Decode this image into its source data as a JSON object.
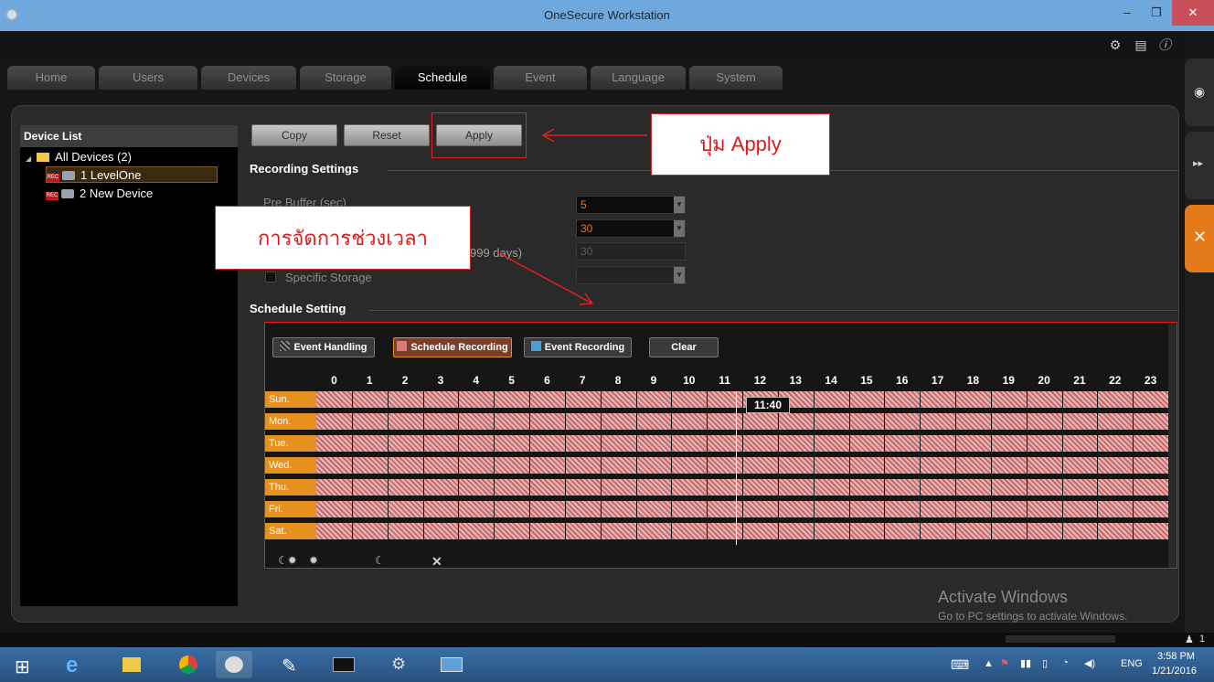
{
  "window": {
    "title": "OneSecure Workstation",
    "minimize": "–",
    "maximize": "❐",
    "close": "✕"
  },
  "tool_icons": [
    "gear-icon",
    "document-icon",
    "info-icon"
  ],
  "tabs": [
    {
      "label": "Home"
    },
    {
      "label": "Users"
    },
    {
      "label": "Devices"
    },
    {
      "label": "Storage"
    },
    {
      "label": "Schedule",
      "active": true
    },
    {
      "label": "Event"
    },
    {
      "label": "Language"
    },
    {
      "label": "System"
    }
  ],
  "device_list": {
    "header": "Device List",
    "root": "All Devices (2)",
    "devices": [
      "1 LevelOne",
      "2 New Device"
    ],
    "selected": "1 LevelOne"
  },
  "actions": {
    "copy": "Copy",
    "reset": "Reset",
    "apply": "Apply"
  },
  "recording": {
    "title": "Recording Settings",
    "pre_buffer_label": "Pre Buffer (sec)",
    "pre_buffer_value": "5",
    "second_value": "30",
    "days_suffix": "999 days)",
    "days_value": "30",
    "specific_storage_label": "Specific Storage"
  },
  "schedule": {
    "title": "Schedule Setting",
    "event_handling": "Event Handling",
    "schedule_recording": "Schedule Recording",
    "event_recording": "Event Recording",
    "clear": "Clear",
    "hours": [
      "0",
      "1",
      "2",
      "3",
      "4",
      "5",
      "6",
      "7",
      "8",
      "9",
      "10",
      "11",
      "12",
      "13",
      "14",
      "15",
      "16",
      "17",
      "18",
      "19",
      "20",
      "21",
      "22",
      "23"
    ],
    "days": [
      "Sun.",
      "Mon.",
      "Tue.",
      "Wed.",
      "Thu.",
      "Fri.",
      "Sat."
    ],
    "cursor_time": "11:40",
    "colors": {
      "schedule_recording": "#d97b7b",
      "event_recording": "#4a9fd6",
      "day_label": "#e6901f"
    }
  },
  "annotations": {
    "apply_callout": "ปุ่ม Apply",
    "time_callout": "การจัดการช่วงเวลา"
  },
  "watermark": {
    "title": "Activate Windows",
    "subtitle": "Go to PC settings to activate Windows."
  },
  "tray": {
    "lang": "ENG",
    "time": "3:58 PM",
    "date": "1/21/2016",
    "users": "1"
  }
}
